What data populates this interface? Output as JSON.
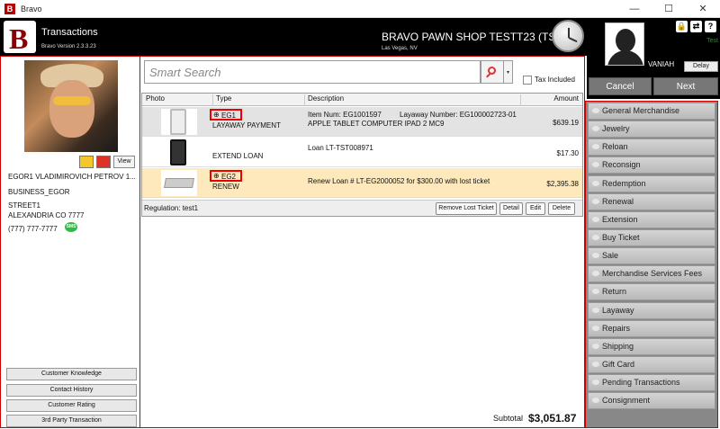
{
  "window": {
    "title": "Bravo",
    "minimize": "—",
    "maximize": "☐",
    "close": "✕"
  },
  "header": {
    "logo_letter": "B",
    "title": "Transactions",
    "version": "Bravo Version 2.3.3.23",
    "shop": "BRAVO PAWN SHOP TESTT23 (TST)",
    "city": "Las Vegas, NV"
  },
  "user": {
    "name": "VANIAH",
    "status": "Test",
    "delay_label": "Delay",
    "icons": [
      "lock-icon",
      "switch-user-icon",
      "help-icon"
    ]
  },
  "nav": {
    "cancel": "Cancel",
    "next": "Next"
  },
  "transaction_types": [
    "General Merchandise",
    "Jewelry",
    "Reloan",
    "Reconsign",
    "Redemption",
    "Renewal",
    "Extension",
    "Buy Ticket",
    "Sale",
    "Merchandise Services Fees",
    "Return",
    "Layaway",
    "Repairs",
    "Shipping",
    "Gift Card",
    "Pending Transactions",
    "Consignment"
  ],
  "customer": {
    "view_label": "View",
    "name": "EGOR1 VLADIMIROVICH PETROV 1...",
    "business": "BUSINESS_EGOR",
    "street": "STREET1",
    "city": "ALEXANDRIA CO 7777",
    "phone": "(777) 777-7777",
    "sms": "SMS",
    "buttons": [
      "Customer Knowledge",
      "Contact History",
      "Customer Rating",
      "3rd Party Transaction"
    ]
  },
  "search": {
    "placeholder": "Smart Search",
    "tax_included": "Tax Included",
    "dropdown": "▾"
  },
  "grid": {
    "columns": [
      "Photo",
      "Type",
      "Description",
      "Amount"
    ],
    "rows": [
      {
        "tag": "EG1",
        "type": "LAYAWAY PAYMENT",
        "desc1": "Item Num: EG1001597",
        "desc1b": "Layaway Number: EG100002723-01",
        "desc2": "APPLE TABLET COMPUTER IPAD 2 MC9",
        "amount": "$639.19"
      },
      {
        "tag": "",
        "type": "EXTEND LOAN",
        "desc1": "Loan LT-TST008971",
        "desc1b": "",
        "desc2": "",
        "amount": "$17.30"
      },
      {
        "tag": "EG2",
        "type": "RENEW",
        "desc1": "Renew Loan # LT-EG2000052 for $300.00 with lost ticket",
        "desc1b": "",
        "desc2": "",
        "amount": "$2,395.38"
      }
    ],
    "regulation": "Regulation: test1",
    "buttons": {
      "remove_lost": "Remove Lost Ticket",
      "detail": "Detail",
      "edit": "Edit",
      "delete": "Delete"
    }
  },
  "totals": {
    "subtotal_label": "Subtotal",
    "subtotal_value": "$3,051.87"
  }
}
